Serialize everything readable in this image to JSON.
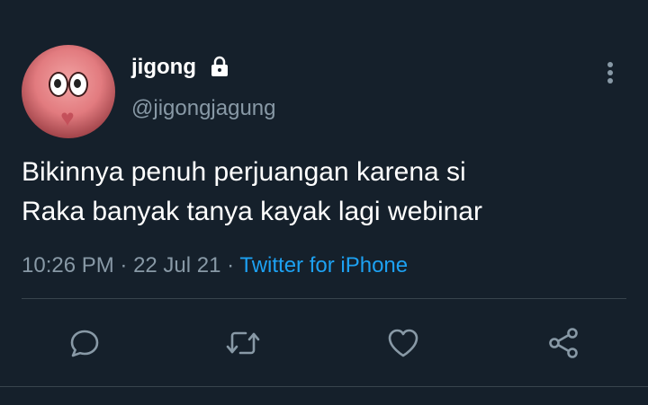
{
  "user": {
    "name": "jigong",
    "handle": "@jigongjagung",
    "protected_icon": "lock-icon"
  },
  "tweet": {
    "text_line1": "Bikinnya penuh perjuangan karena si",
    "text_line2": "Raka banyak tanya kayak lagi webinar",
    "time": "10:26 PM",
    "sep1": " · ",
    "date": "22 Jul 21",
    "sep2": " · ",
    "source": "Twitter for iPhone"
  },
  "actions": [
    {
      "icon": "reply-icon"
    },
    {
      "icon": "retweet-icon"
    },
    {
      "icon": "like-icon"
    },
    {
      "icon": "share-icon"
    }
  ],
  "menu_icon": "more-options-icon",
  "colors": {
    "background": "#15202b",
    "primary_text": "#ffffff",
    "secondary_text": "#8899a6",
    "link": "#1da1f2",
    "divider": "#38444d"
  }
}
